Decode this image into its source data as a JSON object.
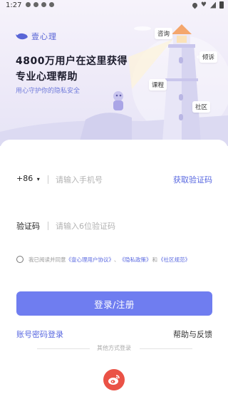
{
  "status_bar": {
    "time": "1:27"
  },
  "brand": {
    "logo_text": "壹心理",
    "brand_color": "#5965d6"
  },
  "hero": {
    "headline_line1": "4800万用户在这里获得",
    "headline_line2": "专业心理帮助",
    "tagline": "用心守护你的隐私安全",
    "chips": [
      "咨询",
      "倾诉",
      "课程",
      "社区"
    ]
  },
  "phone_field": {
    "country_code": "+86",
    "placeholder": "请输入手机号",
    "get_code_label": "获取验证码"
  },
  "code_field": {
    "label": "验证码",
    "placeholder": "请输入6位验证码"
  },
  "agreement": {
    "prefix": "我已阅读并同意",
    "user_agreement": "《壹心理用户协议》",
    "sep1": "、",
    "privacy_policy": "《隐私政策》",
    "and": "和",
    "community_rules": "《社区规范》",
    "checked": false
  },
  "login_button": {
    "label": "登录/注册",
    "color": "#6f7df0"
  },
  "links": {
    "account_password_login": "账号密码登录",
    "help_feedback": "帮助与反馈"
  },
  "other_login": {
    "label": "其他方式登录",
    "providers": [
      {
        "icon": "weibo-icon",
        "color": "#ea5246"
      }
    ]
  },
  "colors": {
    "accent": "#5968e0",
    "hero_bg": "#eeeaf8"
  }
}
